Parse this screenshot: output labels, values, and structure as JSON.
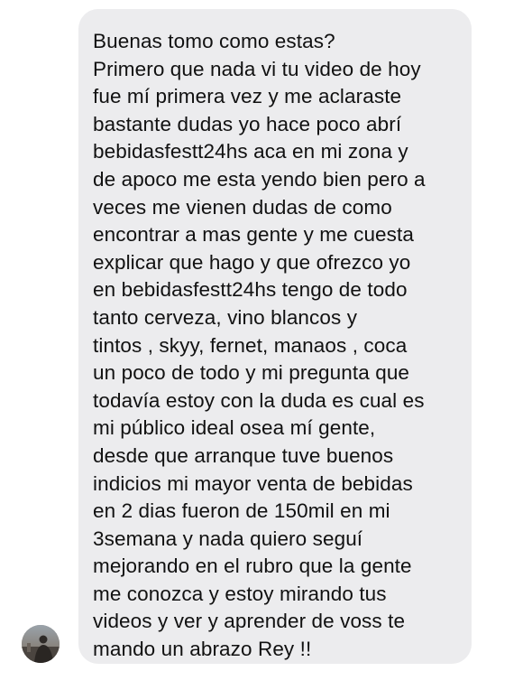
{
  "conversation": {
    "message": {
      "lines": [
        "Buenas tomo como estas?",
        "Primero que nada vi tu video de hoy",
        "fue mí primera vez y me aclaraste",
        "bastante dudas yo hace poco abrí",
        "bebidasfestt24hs aca en mi zona y",
        "de apoco me esta yendo bien pero a",
        "veces me vienen dudas de como",
        "encontrar a mas gente y me cuesta",
        "explicar que hago y que ofrezco yo",
        "en bebidasfestt24hs tengo de todo",
        "tanto cerveza, vino blancos y",
        "tintos , skyy, fernet, manaos , coca",
        "un poco de todo y mi pregunta que",
        "todavía estoy con la duda es cual es",
        "mi público ideal osea mí gente,",
        "desde que arranque tuve buenos",
        "indicios mi mayor venta de bebidas",
        "en 2 dias fueron de 150mil en mi",
        "3semana y nada quiero seguí",
        "mejorando en el rubro que la gente",
        "me conozca y estoy mirando tus",
        "videos y ver y aprender de voss te",
        "mando un abrazo Rey !!"
      ]
    },
    "sender": {
      "avatar_icon": "profile-photo"
    }
  },
  "colors": {
    "bubble_background": "#ececee",
    "text": "#111111",
    "page_background": "#ffffff"
  }
}
